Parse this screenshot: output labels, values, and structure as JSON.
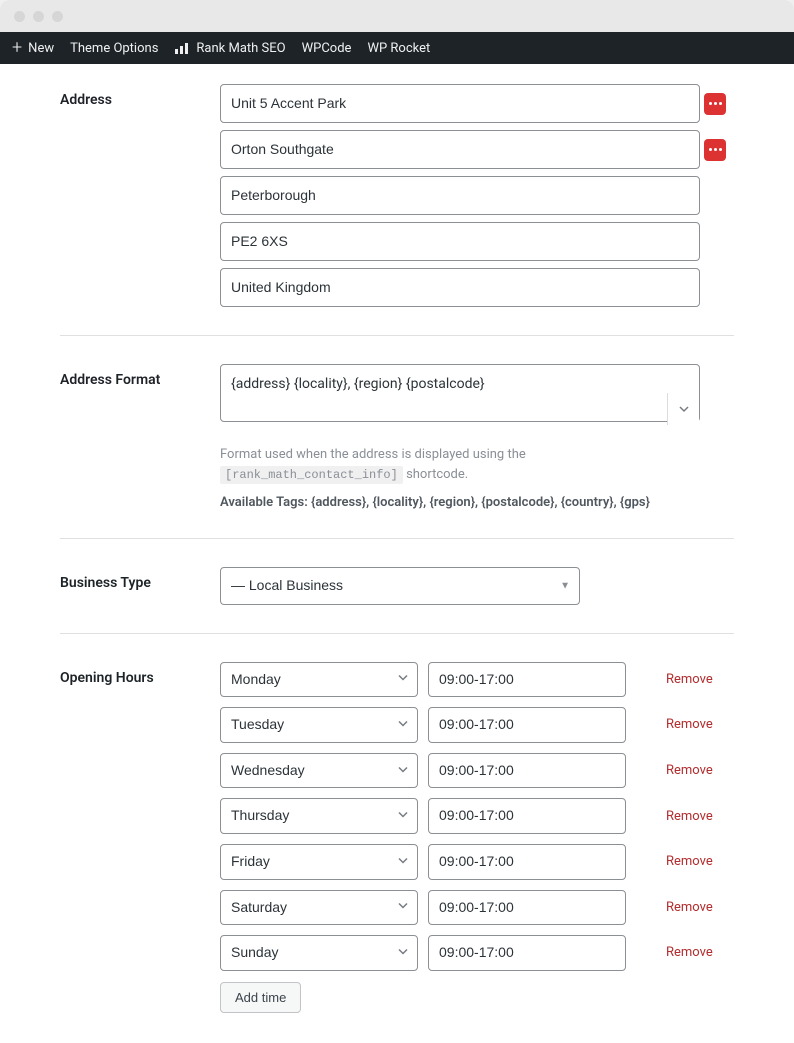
{
  "admin_bar": {
    "new_label": "New",
    "items": [
      "Theme Options",
      "Rank Math SEO",
      "WPCode",
      "WP Rocket"
    ]
  },
  "address": {
    "label": "Address",
    "lines": [
      {
        "value": "Unit 5 Accent Park",
        "badge": true
      },
      {
        "value": "Orton Southgate",
        "badge": true
      },
      {
        "value": "Peterborough",
        "badge": false
      },
      {
        "value": "PE2 6XS",
        "badge": false
      },
      {
        "value": "United Kingdom",
        "badge": false
      }
    ]
  },
  "address_format": {
    "label": "Address Format",
    "value": "{address} {locality}, {region} {postalcode}",
    "help_prefix": "Format used when the address is displayed using the ",
    "help_code": "[rank_math_contact_info]",
    "help_suffix": " shortcode.",
    "tags_label": "Available Tags: {address}, {locality}, {region}, {postalcode}, {country}, {gps}"
  },
  "business_type": {
    "label": "Business Type",
    "value": "— Local Business"
  },
  "opening_hours": {
    "label": "Opening Hours",
    "rows": [
      {
        "day": "Monday",
        "time": "09:00-17:00"
      },
      {
        "day": "Tuesday",
        "time": "09:00-17:00"
      },
      {
        "day": "Wednesday",
        "time": "09:00-17:00"
      },
      {
        "day": "Thursday",
        "time": "09:00-17:00"
      },
      {
        "day": "Friday",
        "time": "09:00-17:00"
      },
      {
        "day": "Saturday",
        "time": "09:00-17:00"
      },
      {
        "day": "Sunday",
        "time": "09:00-17:00"
      }
    ],
    "remove_label": "Remove",
    "add_time_label": "Add time"
  }
}
